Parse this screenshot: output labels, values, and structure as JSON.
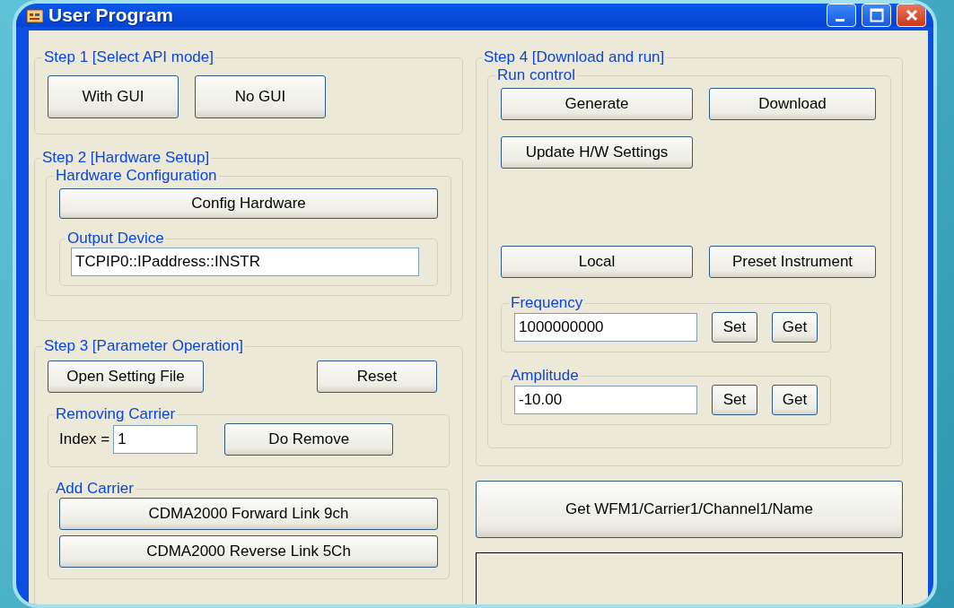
{
  "window": {
    "title": "User Program"
  },
  "step1": {
    "title": "Step 1 [Select API mode]",
    "buttons": [
      "With GUI",
      "No GUI"
    ]
  },
  "step2": {
    "title": "Step 2 [Hardware Setup]",
    "hardware_configuration": {
      "title": "Hardware Configuration",
      "button": "Config Hardware",
      "output_device": {
        "title": "Output Device",
        "value": "TCPIP0::IPaddress::INSTR"
      }
    }
  },
  "step3": {
    "title": "Step 3 [Parameter Operation]",
    "buttons": [
      "Open Setting File",
      "Reset"
    ],
    "removing_carrier": {
      "title": "Removing Carrier",
      "index_label": "Index =",
      "index_value": "1",
      "button": "Do Remove"
    },
    "add_carrier": {
      "title": "Add Carrier",
      "buttons": [
        "CDMA2000 Forward Link 9ch",
        "CDMA2000 Reverse Link 5Ch"
      ]
    }
  },
  "step4": {
    "title": "Step 4 [Download and run]",
    "run_control": {
      "title": "Run control",
      "buttons_top": [
        "Generate",
        "Download"
      ],
      "update_button": "Update H/W Settings",
      "buttons_bottom": [
        "Local",
        "Preset Instrument"
      ],
      "fields": [
        {
          "title": "Frequency",
          "value": "1000000000",
          "set": "Set",
          "get": "Get"
        },
        {
          "title": "Amplitude",
          "value": "-10.00",
          "set": "Set",
          "get": "Get"
        }
      ]
    },
    "get_button": "Get WFM1/Carrier1/Channel1/Name"
  }
}
